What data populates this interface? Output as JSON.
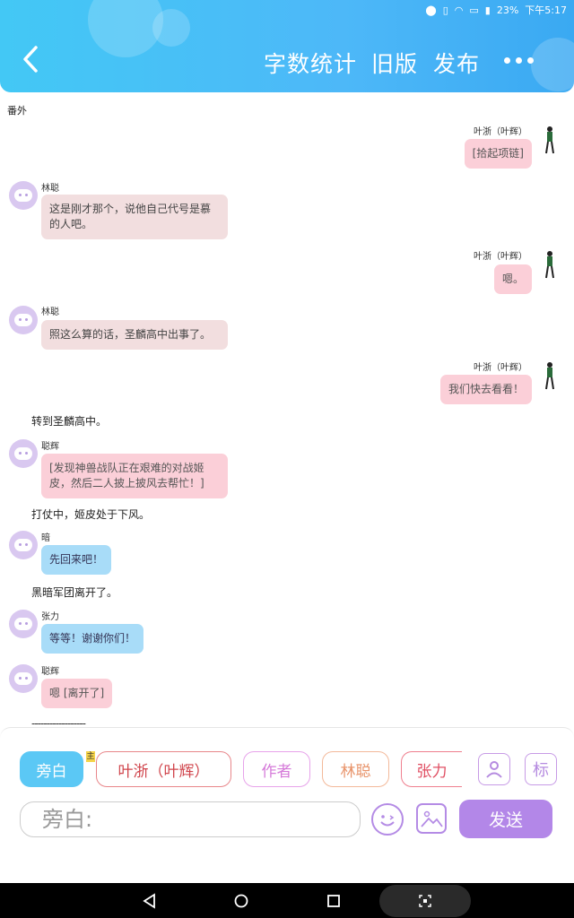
{
  "status": {
    "battery_pct": "23%",
    "time": "下午5:17"
  },
  "header": {
    "word_count": "字数统计",
    "old_version": "旧版",
    "publish": "发布"
  },
  "chapter": "番外",
  "messages": [
    {
      "speaker": "叶浙（叶辉）",
      "text": "[拾起项链]"
    },
    {
      "speaker": "林聪",
      "text": "这是刚才那个，说他自己代号是慕的人吧。"
    },
    {
      "speaker": "叶浙（叶辉）",
      "text": "嗯。"
    },
    {
      "speaker": "林聪",
      "text": "照这么算的话，圣麟高中出事了。"
    },
    {
      "speaker": "叶浙（叶辉）",
      "text": "我们快去看看！"
    },
    {
      "narration": "转到圣麟高中。"
    },
    {
      "speaker": "聪辉",
      "text": "[发现神兽战队正在艰难的对战姬皮，然后二人披上披风去帮忙！]"
    },
    {
      "narration": "打仗中，姬皮处于下风。"
    },
    {
      "speaker": "暗",
      "text": "先回来吧！"
    },
    {
      "narration": "黑暗军团离开了。"
    },
    {
      "speaker": "张力",
      "text": "等等！谢谢你们！"
    },
    {
      "speaker": "聪辉",
      "text": "嗯 [离开了]"
    }
  ],
  "divider": "------------------",
  "roles": {
    "narrator": "旁白",
    "main_badge": "主",
    "items": [
      "叶浙（叶辉）",
      "作者",
      "林聪",
      "张力"
    ],
    "mark": "标"
  },
  "composer": {
    "placeholder": "旁白:",
    "send": "发送"
  }
}
